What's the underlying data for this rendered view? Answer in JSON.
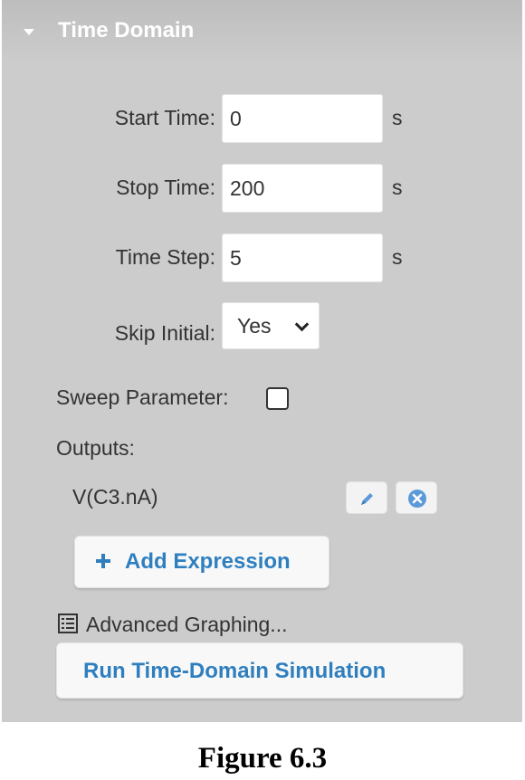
{
  "panel": {
    "title": "Time Domain"
  },
  "fields": {
    "start_time": {
      "label": "Start Time:",
      "value": "0",
      "unit": "s"
    },
    "stop_time": {
      "label": "Stop Time:",
      "value": "200",
      "unit": "s"
    },
    "time_step": {
      "label": "Time Step:",
      "value": "5",
      "unit": "s"
    },
    "skip_initial": {
      "label": "Skip Initial:",
      "selected": "Yes"
    }
  },
  "sweep": {
    "label": "Sweep Parameter:",
    "checked": false
  },
  "outputs": {
    "label": "Outputs:",
    "items": [
      {
        "expression": "V(C3.nA)"
      }
    ]
  },
  "buttons": {
    "add_expression": "Add Expression",
    "advanced_graphing": "Advanced Graphing...",
    "run_simulation": "Run Time-Domain Simulation"
  },
  "colors": {
    "panel_bg": "#cccccc",
    "accent": "#2f7fbf",
    "delete_icon": "#5b9ad8"
  },
  "figure_caption": "Figure 6.3"
}
